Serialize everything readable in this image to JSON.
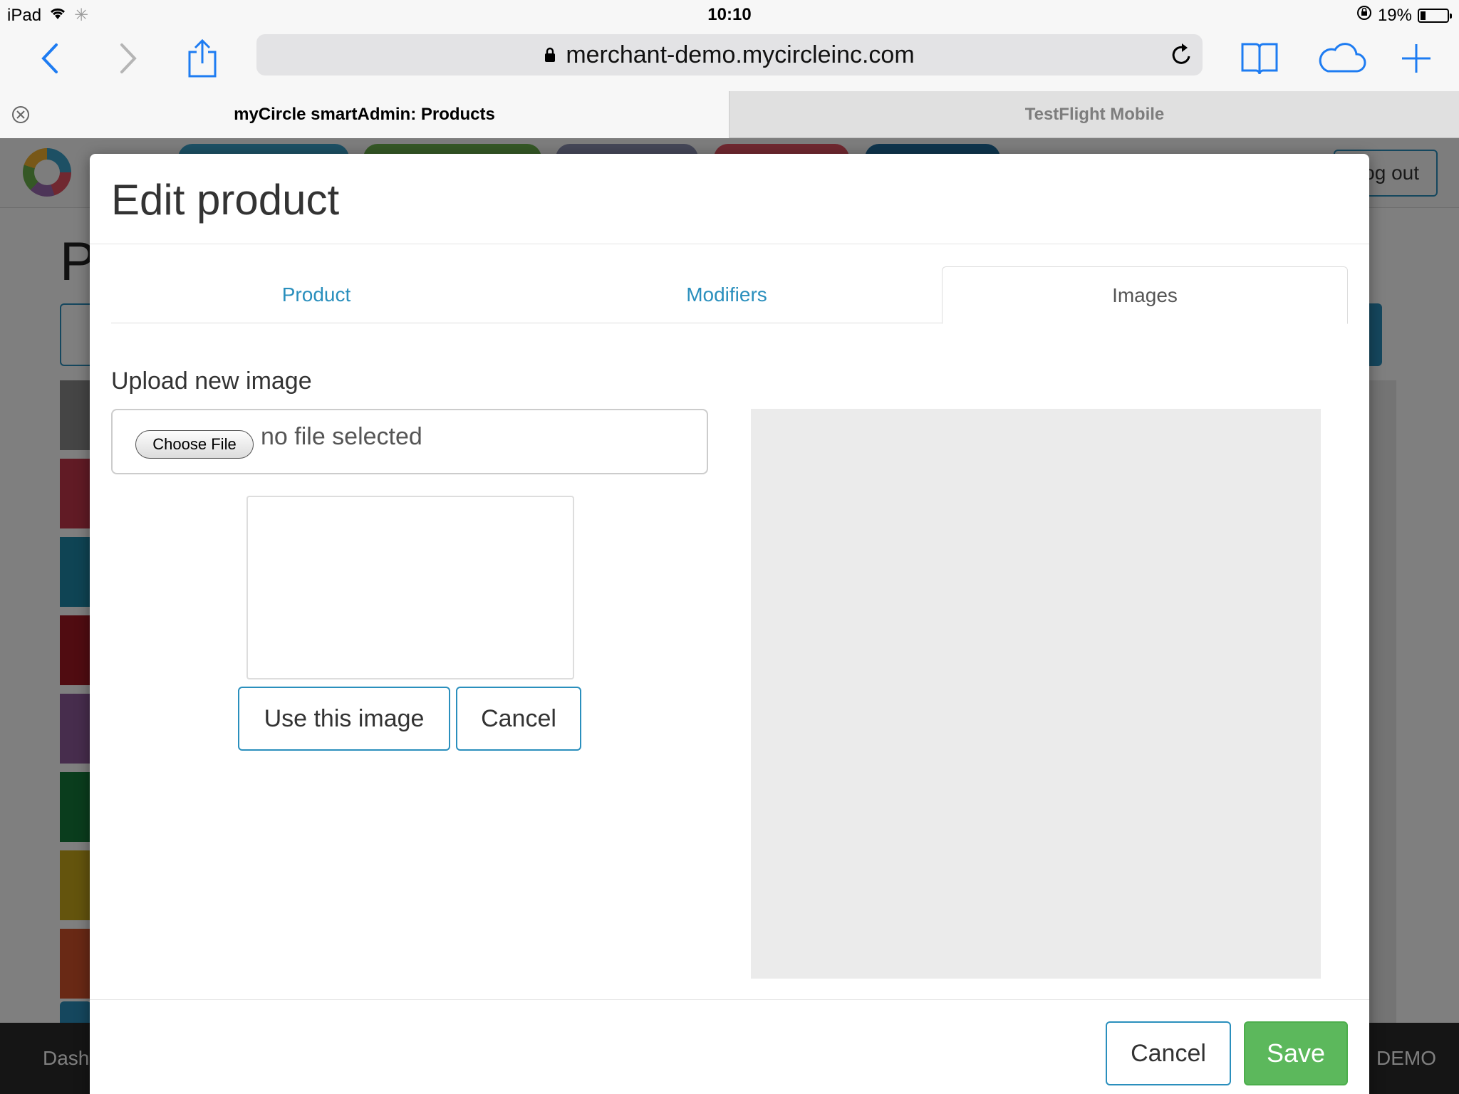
{
  "status_bar": {
    "device": "iPad",
    "time": "10:10",
    "battery_percent": "19%",
    "battery_level": 0.19
  },
  "browser": {
    "url": "merchant-demo.mycircleinc.com",
    "tabs": [
      {
        "label": "myCircle smartAdmin: Products",
        "active": true
      },
      {
        "label": "TestFlight Mobile",
        "active": false
      }
    ],
    "icons": [
      "back-icon",
      "forward-icon",
      "share-icon",
      "lock-icon",
      "reload-icon",
      "bookmarks-icon",
      "cloud-tabs-icon",
      "new-tab-icon"
    ]
  },
  "background_page": {
    "logout_label": "og out",
    "title_fragment": "P",
    "bottom_left": "Dash",
    "bottom_right": ": DEMO",
    "strip_colors": [
      "#8a8a8a",
      "#c2374b",
      "#1e88a8",
      "#a01822",
      "#8e5a9a",
      "#157a3a",
      "#c9a91a",
      "#d2532a"
    ]
  },
  "modal": {
    "title": "Edit product",
    "tabs": [
      {
        "label": "Product",
        "active": false
      },
      {
        "label": "Modifiers",
        "active": false
      },
      {
        "label": "Images",
        "active": true
      }
    ],
    "upload_label": "Upload new image",
    "choose_file_label": "Choose File",
    "no_file_text": "no file selected",
    "use_image_label": "Use this image",
    "cancel_upload_label": "Cancel",
    "footer": {
      "cancel_label": "Cancel",
      "save_label": "Save"
    }
  },
  "colors": {
    "accent": "#2a8fbd",
    "save_green": "#5cb85c",
    "ios_blue": "#1e7cf2"
  }
}
